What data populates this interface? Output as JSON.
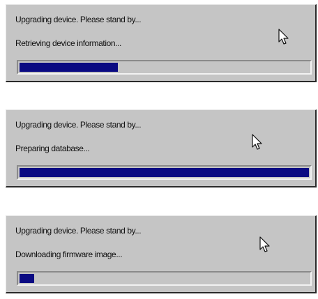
{
  "dialogs": [
    {
      "message": "Upgrading device. Please stand by...",
      "status": "Retrieving device information...",
      "progress_percent": 34
    },
    {
      "message": "Upgrading device. Please stand by...",
      "status": "Preparing database...",
      "progress_percent": 100
    },
    {
      "message": "Upgrading device. Please stand by...",
      "status": "Downloading firmware image...",
      "progress_percent": 5
    }
  ],
  "colors": {
    "dialog_background": "#c5c5c5",
    "progress_fill": "#0a0a82",
    "text": "#111111"
  },
  "icons": {
    "cursor": "mouse-pointer-icon"
  }
}
